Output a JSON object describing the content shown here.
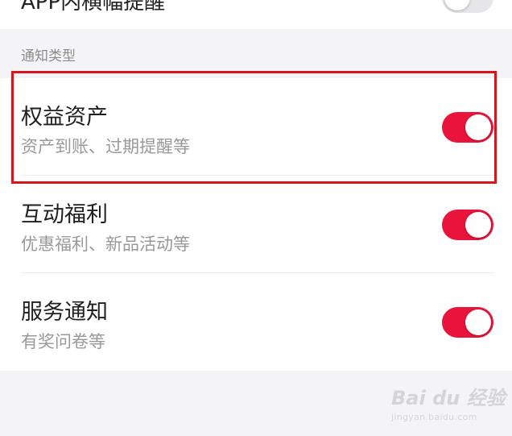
{
  "top_setting": {
    "label": "APP内横幅提醒",
    "enabled": false
  },
  "section": {
    "header": "通知类型"
  },
  "notifications": [
    {
      "title": "权益资产",
      "subtitle": "资产到账、过期提醒等",
      "enabled": true
    },
    {
      "title": "互动福利",
      "subtitle": "优惠福利、新品活动等",
      "enabled": true
    },
    {
      "title": "服务通知",
      "subtitle": "有奖问卷等",
      "enabled": true
    }
  ],
  "colors": {
    "accent": "#e8143c",
    "highlight_border": "#d6161e",
    "toggle_off": "#e6e6e8"
  },
  "watermark": {
    "logo": "Bai du 经验",
    "url": "jingyan.baidu.com"
  }
}
